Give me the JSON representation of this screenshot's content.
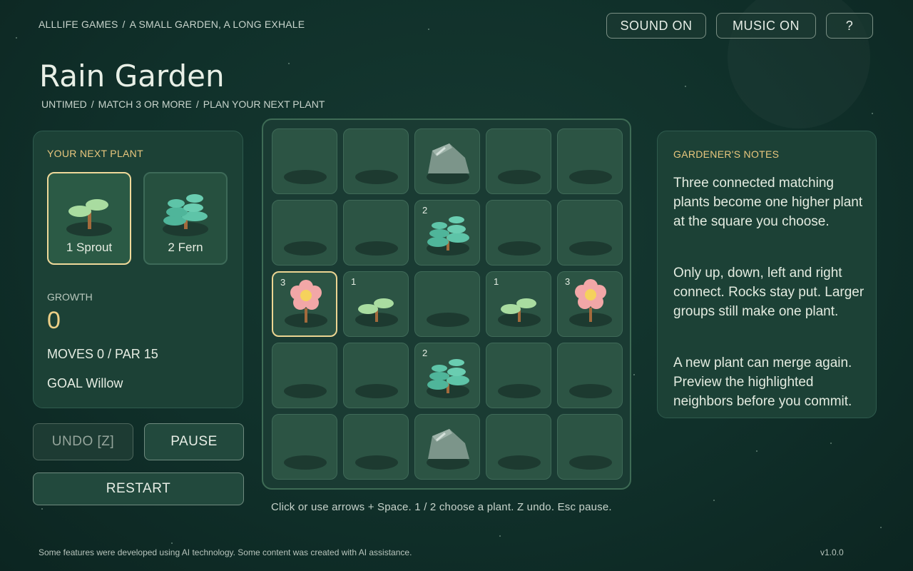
{
  "breadcrumb": {
    "publisher": "ALLLIFE GAMES",
    "separator": "/",
    "game": "A SMALL GARDEN, A LONG EXHALE"
  },
  "top_buttons": {
    "sound": "SOUND ON",
    "music": "MUSIC ON",
    "help": "?"
  },
  "title": "Rain Garden",
  "subtitle": {
    "part1": "UNTIMED",
    "part2": "MATCH 3 OR MORE",
    "part3": "PLAN YOUR NEXT PLANT",
    "separator": "/"
  },
  "next_plant": {
    "label": "YOUR NEXT PLANT",
    "options": [
      {
        "key": "1",
        "name": "Sprout",
        "text": "1  Sprout",
        "selected": true
      },
      {
        "key": "2",
        "name": "Fern",
        "text": "2  Fern",
        "selected": false
      }
    ]
  },
  "stats": {
    "growth_label": "GROWTH",
    "growth_value": "0",
    "moves_text": "MOVES  0 / PAR 15",
    "goal_text": "GOAL  Willow"
  },
  "buttons": {
    "undo": "UNDO  [Z]",
    "pause": "PAUSE",
    "restart": "RESTART"
  },
  "board": {
    "rows": 5,
    "cols": 5,
    "selected_cell": [
      2,
      0
    ],
    "cells": [
      [
        null,
        null,
        {
          "type": "rock"
        },
        null,
        null
      ],
      [
        null,
        null,
        {
          "type": "fern",
          "count": "2"
        },
        null,
        null
      ],
      [
        {
          "type": "flower",
          "count": "3"
        },
        {
          "type": "sprout",
          "count": "1"
        },
        null,
        {
          "type": "sprout",
          "count": "1"
        },
        {
          "type": "flower",
          "count": "3"
        }
      ],
      [
        null,
        null,
        {
          "type": "fern",
          "count": "2"
        },
        null,
        null
      ],
      [
        null,
        null,
        {
          "type": "rock"
        },
        null,
        null
      ]
    ]
  },
  "hint": "Click or use arrows + Space.  1 / 2 choose a plant.  Z undo.  Esc pause.",
  "notes": {
    "label": "GARDENER'S NOTES",
    "paragraphs": [
      "Three connected matching plants become one higher plant at the square you choose.",
      "Only up, down, left and right connect. Rocks stay put. Larger groups still make one plant.",
      "A new plant can merge again. Preview the highlighted neighbors before you commit."
    ]
  },
  "footer": "Some features were developed using AI technology. Some content was created with AI assistance.",
  "version": "v1.0.0",
  "colors": {
    "accent": "#edcf87",
    "panel": "#1c4136",
    "cell": "#2c5444",
    "selected_border": "#ecd592"
  }
}
